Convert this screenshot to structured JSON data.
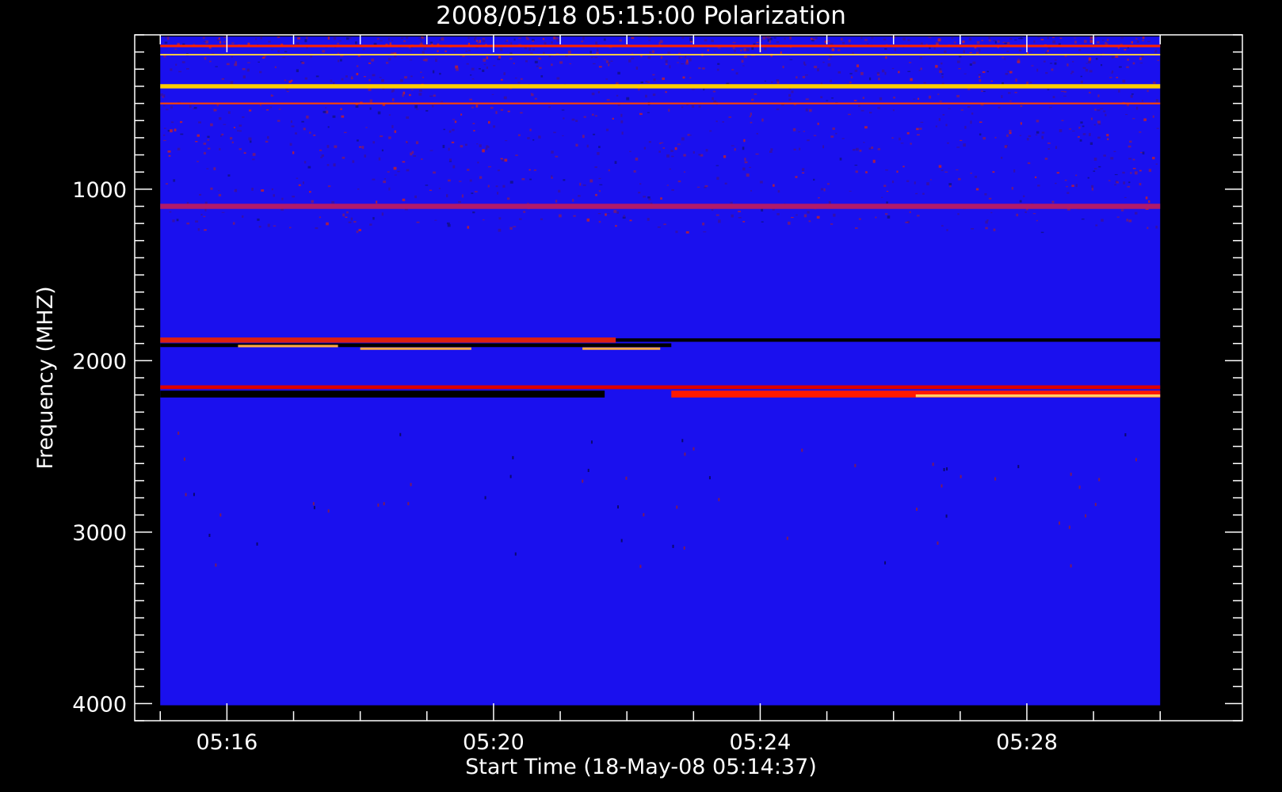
{
  "chart_data": {
    "type": "heatmap",
    "title": "2008/05/18 05:15:00 Polarization",
    "xlabel": "Start Time (18-May-08 05:14:37)",
    "ylabel": "Frequency (MHZ)",
    "x_ticks": [
      "05:16",
      "05:20",
      "05:24",
      "05:28"
    ],
    "y_ticks": [
      1000,
      2000,
      3000,
      4000
    ],
    "xlim": [
      "05:14:37",
      "05:31:14"
    ],
    "ylim": [
      4100,
      100
    ],
    "data_time_range": [
      "05:15:00",
      "05:30:00"
    ],
    "data_freq_range_mhz": [
      110,
      4010
    ],
    "colormap": "black-blue-red-yellow-white",
    "background_color": "#1a10ee",
    "features": [
      {
        "freq_mhz": 165,
        "t_start": "05:15:00",
        "t_end": "05:30:00",
        "color": "#ff2200",
        "thickness_mhz": 14
      },
      {
        "freq_mhz": 215,
        "t_start": "05:15:00",
        "t_end": "05:30:00",
        "color": "#ffcc44",
        "thickness_mhz": 8
      },
      {
        "freq_mhz": 400,
        "t_start": "05:15:00",
        "t_end": "05:30:00",
        "color": "#ffcc00",
        "thickness_mhz": 25
      },
      {
        "freq_mhz": 500,
        "t_start": "05:15:00",
        "t_end": "05:30:00",
        "color": "#ff4400",
        "thickness_mhz": 10
      },
      {
        "freq_mhz": 1100,
        "t_start": "05:15:00",
        "t_end": "05:30:00",
        "color": "#b01a6a",
        "thickness_mhz": 30
      },
      {
        "freq_mhz": 1880,
        "t_start": "05:15:00",
        "t_end": "05:21:50",
        "color": "#dd2010",
        "thickness_mhz": 30
      },
      {
        "freq_mhz": 1880,
        "t_start": "05:21:50",
        "t_end": "05:30:00",
        "color": "#000000",
        "thickness_mhz": 20
      },
      {
        "freq_mhz": 1910,
        "t_start": "05:15:00",
        "t_end": "05:22:40",
        "color": "#000000",
        "thickness_mhz": 22
      },
      {
        "freq_mhz": 1915,
        "t_start": "05:16:10",
        "t_end": "05:17:40",
        "color": "#ffaa44",
        "thickness_mhz": 14
      },
      {
        "freq_mhz": 1930,
        "t_start": "05:18:00",
        "t_end": "05:19:40",
        "color": "#ffaa44",
        "thickness_mhz": 14
      },
      {
        "freq_mhz": 1930,
        "t_start": "05:21:20",
        "t_end": "05:22:30",
        "color": "#ffaa44",
        "thickness_mhz": 14
      },
      {
        "freq_mhz": 2155,
        "t_start": "05:15:00",
        "t_end": "05:30:00",
        "color": "#dd0000",
        "thickness_mhz": 22
      },
      {
        "freq_mhz": 2195,
        "t_start": "05:15:00",
        "t_end": "05:21:40",
        "color": "#000000",
        "thickness_mhz": 40
      },
      {
        "freq_mhz": 2195,
        "t_start": "05:22:40",
        "t_end": "05:30:00",
        "color": "#ff1a00",
        "thickness_mhz": 40
      },
      {
        "freq_mhz": 2205,
        "t_start": "05:26:20",
        "t_end": "05:30:00",
        "color": "#ffcc66",
        "thickness_mhz": 16
      }
    ]
  }
}
